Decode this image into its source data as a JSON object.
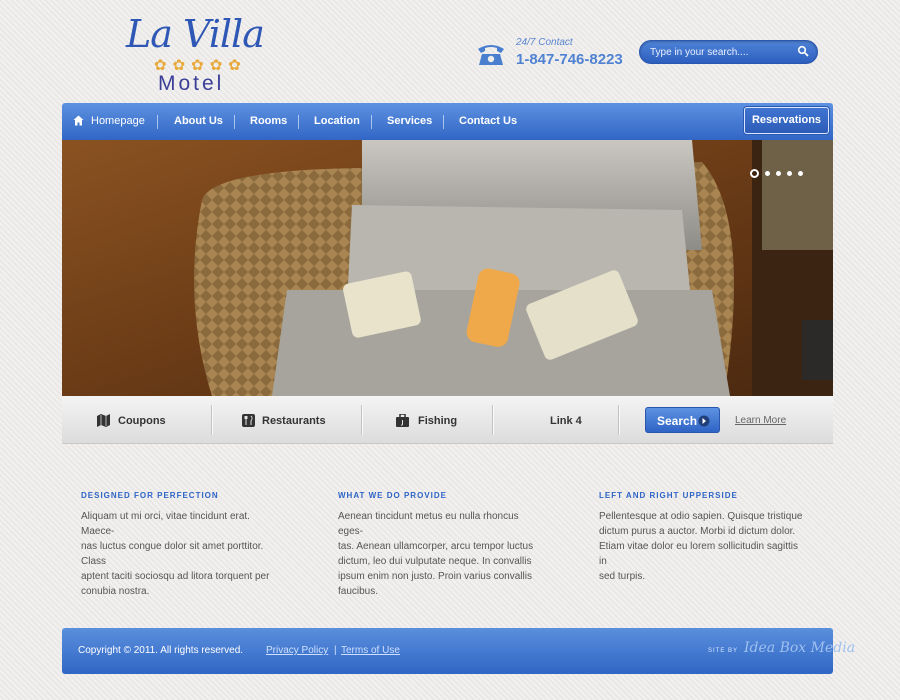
{
  "logo": {
    "script": "La Villa",
    "stars": "✿✿✿✿✿",
    "subtitle": "Motel"
  },
  "contact": {
    "label": "24/7 Contact",
    "phone": "1-847-746-8223"
  },
  "search": {
    "placeholder": "Type in your search...."
  },
  "nav": {
    "items": [
      {
        "label": "Homepage"
      },
      {
        "label": "About Us"
      },
      {
        "label": "Rooms"
      },
      {
        "label": "Location"
      },
      {
        "label": "Services"
      },
      {
        "label": "Contact Us"
      }
    ],
    "reservations": "Reservations"
  },
  "hero": {
    "slide_count": 5,
    "active_slide": 1
  },
  "quicklinks": {
    "items": [
      {
        "label": "Coupons",
        "icon": "map-icon"
      },
      {
        "label": "Restaurants",
        "icon": "utensils-icon"
      },
      {
        "label": "Fishing",
        "icon": "tackle-box-icon"
      },
      {
        "label": "Link 4"
      }
    ],
    "search_button": "Search",
    "learn_more": "Learn More"
  },
  "columns": [
    {
      "title": "DESIGNED FOR PERFECTION",
      "lines": [
        "Aliquam ut mi orci, vitae tincidunt erat. Maece-",
        "nas luctus congue dolor sit amet porttitor. Class",
        "aptent taciti sociosqu ad litora torquent per",
        "conubia nostra."
      ]
    },
    {
      "title": "WHAT WE DO PROVIDE",
      "lines": [
        "Aenean tincidunt metus eu nulla rhoncus eges-",
        "tas. Aenean ullamcorper, arcu tempor luctus",
        "dictum, leo dui vulputate neque. In convallis",
        "ipsum enim non justo. Proin varius convallis",
        "faucibus."
      ]
    },
    {
      "title": "LEFT AND RIGHT UPPERSIDE",
      "lines": [
        "Pellentesque at odio sapien. Quisque tristique",
        "dictum purus a auctor. Morbi id dictum dolor.",
        "Etiam vitae dolor eu lorem sollicitudin sagittis in",
        "sed turpis."
      ]
    }
  ],
  "footer": {
    "copyright": "Copyright © 2011. All rights reserved.",
    "privacy": "Privacy Policy",
    "divider": "|",
    "terms": "Terms of Use",
    "site_by": "SITE BY",
    "maker": "Idea Box Media"
  },
  "colors": {
    "brand_blue": "#3a6fcb",
    "accent_gold": "#e8a93a",
    "heading_blue": "#2e64c7"
  }
}
